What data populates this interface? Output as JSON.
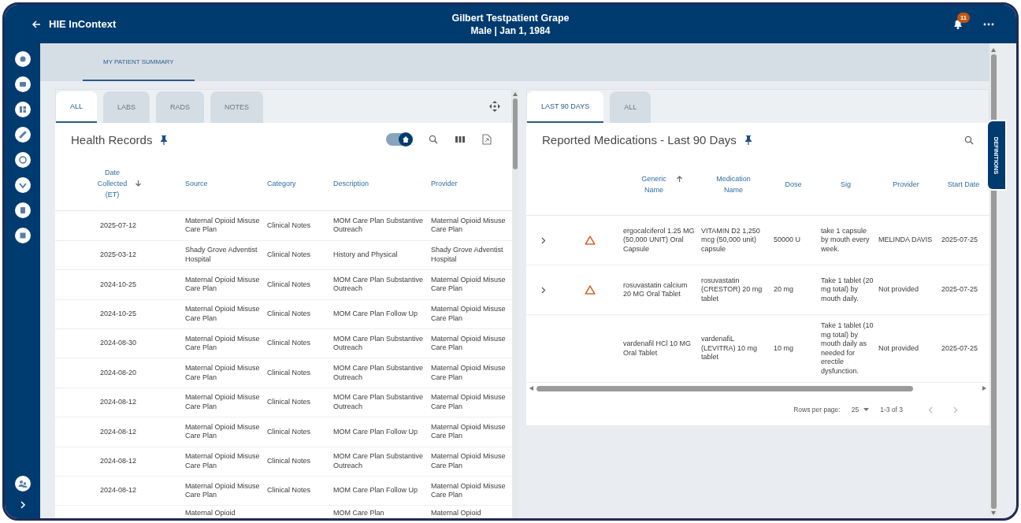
{
  "header": {
    "app_title": "HIE InContext",
    "patient_name": "Gilbert Testpatient Grape",
    "patient_details": "Male | Jan 1, 1984",
    "notification_count": "11"
  },
  "page_tabs": [
    {
      "label": "MY PATIENT SUMMARY",
      "selected": true
    }
  ],
  "health_records": {
    "tabs": [
      {
        "label": "ALL",
        "selected": true
      },
      {
        "label": "LABS",
        "selected": false
      },
      {
        "label": "RADS",
        "selected": false
      },
      {
        "label": "NOTES",
        "selected": false
      }
    ],
    "title": "Health Records",
    "home_filter_on": true,
    "columns": [
      {
        "label": "Date Collected (ET)",
        "sorted": true,
        "ascending": false
      },
      {
        "label": "Source",
        "sorted": false
      },
      {
        "label": "Category",
        "sorted": false
      },
      {
        "label": "Description",
        "sorted": false
      },
      {
        "label": "Provider",
        "sorted": false
      }
    ],
    "rows": [
      {
        "date_collected": "2025-07-12",
        "source": "Maternal Opioid Misuse Care Plan",
        "category": "Clinical Notes",
        "description": "MOM Care Plan Substantive Outreach",
        "provider": "Maternal Opioid Misuse Care Plan"
      },
      {
        "date_collected": "2025-03-12",
        "source": "Shady Grove Adventist Hospital",
        "category": "Clinical Notes",
        "description": "History and Physical",
        "provider": "Shady Grove Adventist Hospital"
      },
      {
        "date_collected": "2024-10-25",
        "source": "Maternal Opioid Misuse Care Plan",
        "category": "Clinical Notes",
        "description": "MOM Care Plan Substantive Outreach",
        "provider": "Maternal Opioid Misuse Care Plan"
      },
      {
        "date_collected": "2024-10-25",
        "source": "Maternal Opioid Misuse Care Plan",
        "category": "Clinical Notes",
        "description": "MOM Care Plan Follow Up",
        "provider": "Maternal Opioid Misuse Care Plan"
      },
      {
        "date_collected": "2024-08-30",
        "source": "Maternal Opioid Misuse Care Plan",
        "category": "Clinical Notes",
        "description": "MOM Care Plan Substantive Outreach",
        "provider": "Maternal Opioid Misuse Care Plan"
      },
      {
        "date_collected": "2024-08-20",
        "source": "Maternal Opioid Misuse Care Plan",
        "category": "Clinical Notes",
        "description": "MOM Care Plan Substantive Outreach",
        "provider": "Maternal Opioid Misuse Care Plan"
      },
      {
        "date_collected": "2024-08-12",
        "source": "Maternal Opioid Misuse Care Plan",
        "category": "Clinical Notes",
        "description": "MOM Care Plan Substantive Outreach",
        "provider": "Maternal Opioid Misuse Care Plan"
      },
      {
        "date_collected": "2024-08-12",
        "source": "Maternal Opioid Misuse Care Plan",
        "category": "Clinical Notes",
        "description": "MOM Care Plan Follow Up",
        "provider": "Maternal Opioid Misuse Care Plan"
      },
      {
        "date_collected": "2024-08-12",
        "source": "Maternal Opioid Misuse Care Plan",
        "category": "Clinical Notes",
        "description": "MOM Care Plan Substantive Outreach",
        "provider": "Maternal Opioid Misuse Care Plan"
      },
      {
        "date_collected": "2024-08-12",
        "source": "Maternal Opioid Misuse Care Plan",
        "category": "Clinical Notes",
        "description": "MOM Care Plan Follow Up",
        "provider": "Maternal Opioid Misuse Care Plan"
      },
      {
        "source": "Maternal Opioid",
        "description": "MOM Care Plan",
        "provider": "Maternal Opioid"
      }
    ]
  },
  "medications": {
    "tabs": [
      {
        "label": "LAST 90 DAYS",
        "selected": true
      },
      {
        "label": "ALL",
        "selected": false
      }
    ],
    "title": "Reported Medications - Last 90 Days",
    "columns": [
      {
        "label": "Generic Name",
        "sorted": true,
        "ascending": true
      },
      {
        "label": "Medication Name",
        "sorted": false
      },
      {
        "label": "Dose",
        "sorted": false
      },
      {
        "label": "Sig",
        "sorted": false
      },
      {
        "label": "Provider",
        "sorted": false
      },
      {
        "label": "Start Date",
        "sorted": false
      }
    ],
    "rows": [
      {
        "expandable": true,
        "warning": true,
        "generic_name": "ergocalciferol 1.25 MG (50,000 UNIT) Oral Capsule",
        "medication_name": "VITAMIN D2 1,250 mcg (50,000 unit) capsule",
        "dose": "50000 U",
        "sig": "take 1 capsule by mouth every week.",
        "provider": "MELINDA DAVIS",
        "start_date": "2025-07-25"
      },
      {
        "expandable": true,
        "warning": true,
        "generic_name": "rosuvastatin calcium 20 MG Oral Tablet",
        "medication_name": "rosuvastatin (CRESTOR) 20 mg tablet",
        "dose": "20 mg",
        "sig": "Take 1 tablet (20 mg total) by mouth daily.",
        "provider": "Not provided",
        "start_date": "2025-07-25"
      },
      {
        "expandable": false,
        "warning": false,
        "generic_name": "vardenafil HCl 10 MG Oral Tablet",
        "medication_name": "vardenafiL (LEVITRA) 10 mg tablet",
        "dose": "10 mg",
        "sig": "Take 1 tablet (10 mg total) by mouth daily as needed for erectile dysfunction.",
        "provider": "Not provided",
        "start_date": "2025-07-25"
      }
    ],
    "pagination": {
      "rows_per_page_label": "Rows per page:",
      "rows_per_page": "25",
      "range": "1-3 of 3"
    }
  },
  "definitions_tab": "DEFINITIONS"
}
